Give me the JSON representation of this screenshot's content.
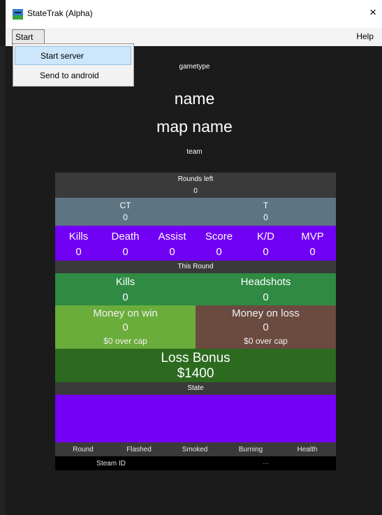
{
  "window": {
    "title": "StateTrak (Alpha)",
    "close_glyph": "×"
  },
  "menubar": {
    "start": "Start",
    "help": "Help"
  },
  "dropdown": {
    "items": [
      "Start server",
      "Send to android"
    ]
  },
  "header": {
    "gametype": "gametype",
    "name": "name",
    "map_name": "map name",
    "team": "team"
  },
  "rounds_left": {
    "label": "Rounds left",
    "value": "0"
  },
  "teams": {
    "ct_label": "CT",
    "ct_value": "0",
    "t_label": "T",
    "t_value": "0"
  },
  "stats": {
    "labels": [
      "Kills",
      "Death",
      "Assist",
      "Score",
      "K/D",
      "MVP"
    ],
    "values": [
      "0",
      "0",
      "0",
      "0",
      "0",
      "0"
    ]
  },
  "this_round": {
    "label": "This Round",
    "kills_label": "Kills",
    "kills_value": "0",
    "headshots_label": "Headshots",
    "headshots_value": "0"
  },
  "money": {
    "win_label": "Money on win",
    "win_value": "0",
    "win_cap": "$0 over cap",
    "loss_label": "Money on loss",
    "loss_value": "0",
    "loss_cap": "$0 over cap"
  },
  "loss_bonus": {
    "label": "Loss Bonus",
    "value": "$1400"
  },
  "state": {
    "label": "State"
  },
  "footer": {
    "columns": [
      "Round",
      "Flashed",
      "Smoked",
      "Burning",
      "Health"
    ],
    "steam_label": "Steam ID",
    "steam_value": "..."
  },
  "colors": {
    "dark_row": "#3a3a3a",
    "ct_t": "#5d7583",
    "stats": "#7101f5",
    "this_round": "#2f8a43",
    "money_win": "#6aad3b",
    "money_loss": "#6b4a3f",
    "loss_bonus": "#2b6a1f",
    "state_box": "#7301f5"
  }
}
